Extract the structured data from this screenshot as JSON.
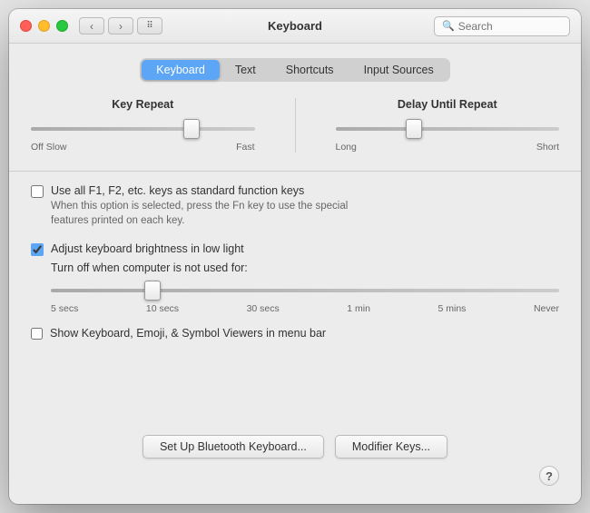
{
  "window": {
    "title": "Keyboard"
  },
  "titlebar": {
    "title": "Keyboard",
    "search_placeholder": "Search",
    "nav_back": "‹",
    "nav_forward": "›",
    "grid_icon": "⊞"
  },
  "tabs": [
    {
      "id": "keyboard",
      "label": "Keyboard",
      "active": true
    },
    {
      "id": "text",
      "label": "Text",
      "active": false
    },
    {
      "id": "shortcuts",
      "label": "Shortcuts",
      "active": false
    },
    {
      "id": "input-sources",
      "label": "Input Sources",
      "active": false
    }
  ],
  "key_repeat": {
    "label": "Key Repeat",
    "left_label": "Off  Slow",
    "right_label": "Fast",
    "thumb_position_pct": 72
  },
  "delay_until_repeat": {
    "label": "Delay Until Repeat",
    "left_label": "Long",
    "right_label": "Short",
    "thumb_position_pct": 35
  },
  "checkbox_fn": {
    "label": "Use all F1, F2, etc. keys as standard function keys",
    "sublabel": "When this option is selected, press the Fn key to use the special\nfeatures printed on each key.",
    "checked": false
  },
  "checkbox_brightness": {
    "label": "Adjust keyboard brightness in low light",
    "checked": true
  },
  "turn_off_label": "Turn off when computer is not used for:",
  "timer_labels": [
    "5 secs",
    "10 secs",
    "30 secs",
    "1 min",
    "5 mins",
    "Never"
  ],
  "timer_thumb_pct": 20,
  "checkbox_emoji": {
    "label": "Show Keyboard, Emoji, & Symbol Viewers in menu bar",
    "checked": false
  },
  "buttons": {
    "bluetooth": "Set Up Bluetooth Keyboard...",
    "modifier": "Modifier Keys..."
  },
  "help_label": "?"
}
